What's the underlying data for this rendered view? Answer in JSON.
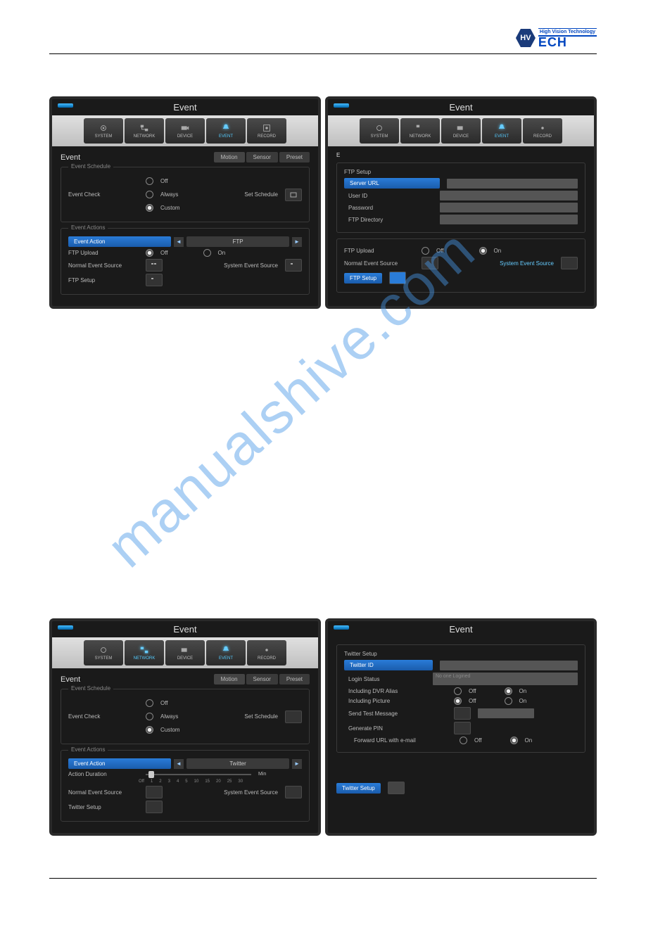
{
  "brand": {
    "tagline": "High Vision Technology",
    "name": "ECH",
    "hex": "HV"
  },
  "toolbar": [
    "SYSTEM",
    "NETWORK",
    "DEVICE",
    "EVENT",
    "RECORD"
  ],
  "window_title": "Event",
  "section_label": "Event",
  "subtabs": [
    "Motion",
    "Sensor",
    "Preset"
  ],
  "fs": {
    "schedule": "Event Schedule",
    "actions": "Event Actions"
  },
  "lbl": {
    "event_check": "Event Check",
    "off": "Off",
    "always": "Always",
    "custom": "Custom",
    "on": "On",
    "set_schedule": "Set Schedule",
    "event_action": "Event Action",
    "ftp": "FTP",
    "ftp_upload": "FTP Upload",
    "normal_src": "Normal Event Source",
    "system_src": "System Event Source",
    "ftp_setup": "FTP Setup",
    "server_url": "Server URL",
    "user_id": "User ID",
    "password": "Password",
    "ftp_dir": "FTP Directory",
    "twitter": "Twitter",
    "action_duration": "Action Duration",
    "twitter_setup": "Twitter Setup",
    "twitter_id": "Twitter ID",
    "login_status": "Login Status",
    "login_status_val": "No one Logined",
    "inc_alias": "Including DVR Alias",
    "inc_pic": "Including Picture",
    "send_test": "Send Test Message",
    "gen_pin": "Generate PIN",
    "fwd_url": "Forward URL with e-mail",
    "min": "Min"
  },
  "slider_ticks": [
    "Off",
    "1",
    "2",
    "3",
    "4",
    "5",
    "10",
    "15",
    "20",
    "25",
    "30"
  ],
  "watermark": "manualshive.com"
}
